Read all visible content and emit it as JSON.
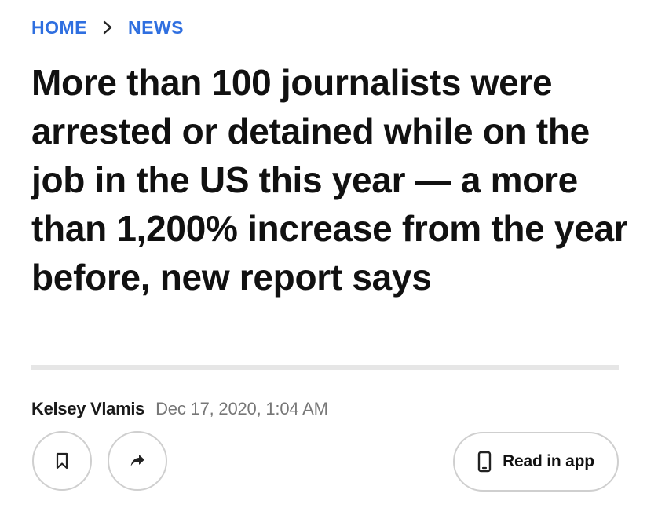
{
  "breadcrumb": {
    "home": "HOME",
    "section": "NEWS",
    "separator_icon": "chevron-right-icon"
  },
  "article": {
    "headline": "More than 100 journalists were arrested or detained while on the job in the US this year — a more than 1,200% increase from the year before, new report says",
    "author": "Kelsey Vlamis",
    "published": "Dec 17, 2020, 1:04 AM"
  },
  "actions": {
    "bookmark_icon": "bookmark-icon",
    "share_icon": "share-arrow-icon",
    "read_in_app_icon": "phone-icon",
    "read_in_app_label": "Read in app"
  },
  "colors": {
    "link": "#2f6fe0",
    "text": "#111111",
    "muted": "#777777",
    "divider": "#e6e6e6",
    "button_border": "#cfcfcf"
  }
}
